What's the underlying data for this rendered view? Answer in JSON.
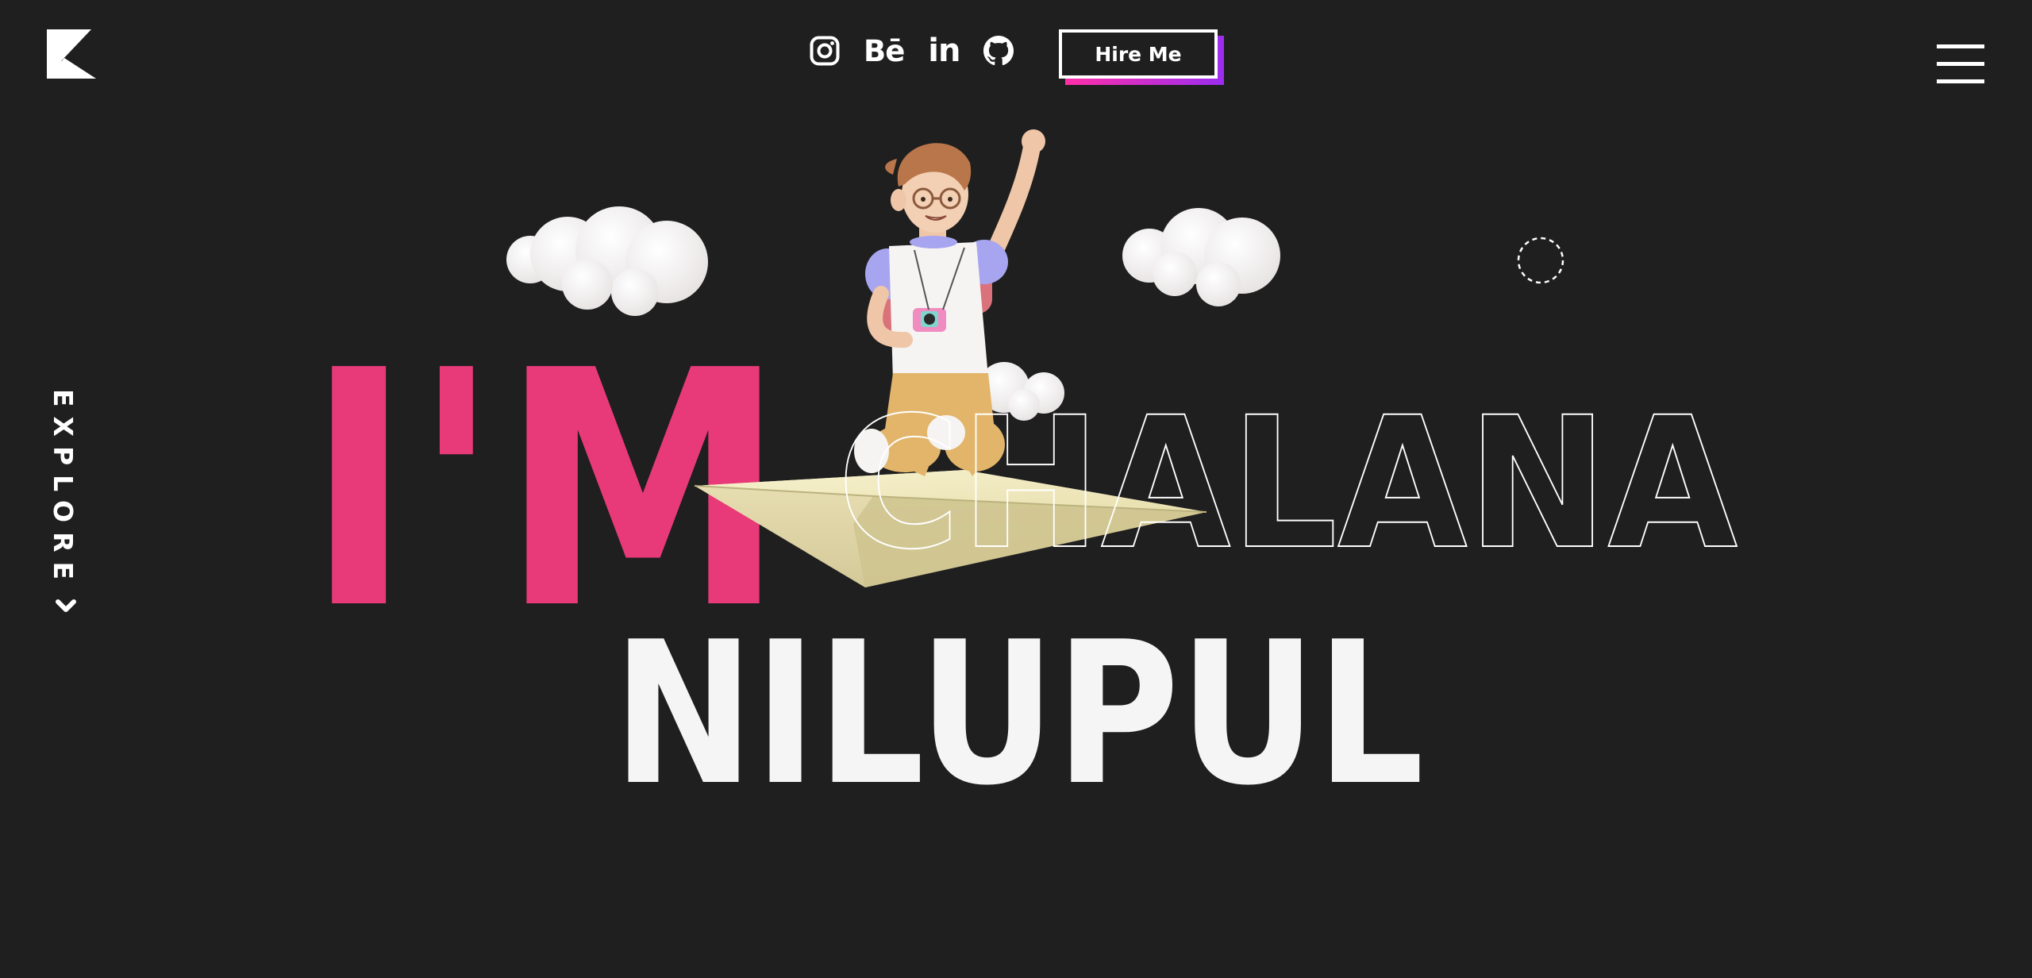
{
  "header": {
    "logo_icon": "k-logo-icon",
    "social": [
      {
        "name": "instagram",
        "icon": "instagram-icon"
      },
      {
        "name": "behance",
        "icon": "behance-icon",
        "glyph": "Bē"
      },
      {
        "name": "linkedin",
        "icon": "linkedin-icon",
        "glyph": "in"
      },
      {
        "name": "github",
        "icon": "github-icon"
      }
    ],
    "hire_label": "Hire Me",
    "menu_icon": "hamburger-menu-icon"
  },
  "sidebar": {
    "explore_label": "EXPLORE",
    "explore_icon": "chevron-down-icon"
  },
  "hero": {
    "line1_prefix": "I'M",
    "line1_name": "CHALANA",
    "line2": "NILUPUL",
    "illustration": "boy-on-paper-plane-with-clouds"
  },
  "colors": {
    "background": "#1f1f1f",
    "accent_pink": "#e83a78",
    "text_white": "#f5f5f5",
    "hire_shadow_start": "#ff2fa8",
    "hire_shadow_end": "#9b2df0"
  }
}
